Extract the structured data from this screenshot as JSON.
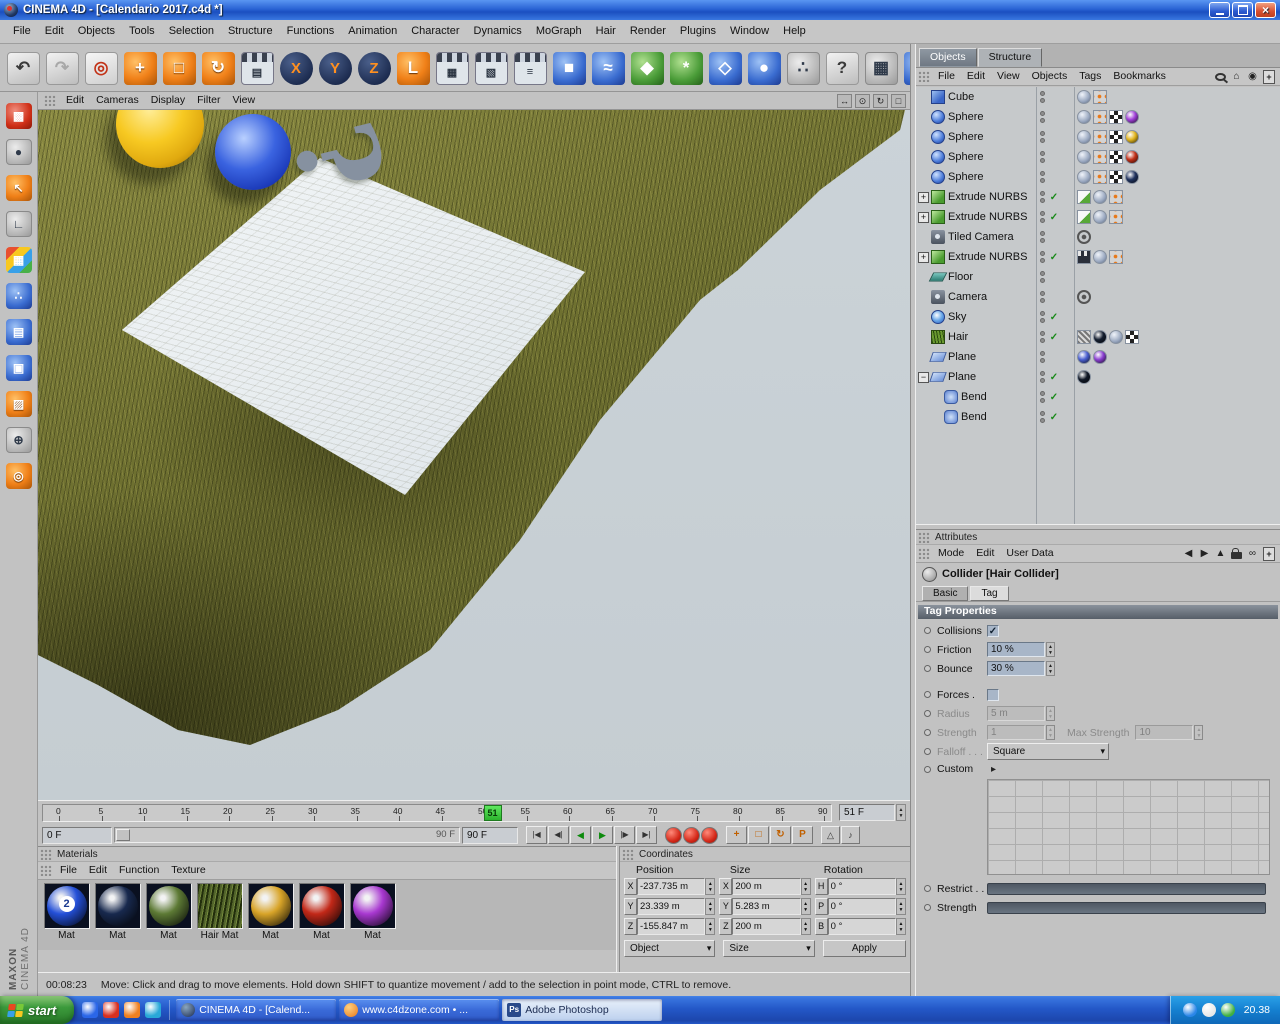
{
  "scene_colors": {
    "background": "#cbd3d8",
    "grass_light": "#8a8a42",
    "grass_dark": "#4f5222",
    "card": "#e2e8ec",
    "sphere_yellow": "#f7c922",
    "sphere_blue": "#3a63e0",
    "question_mark": "#8691a0"
  },
  "scene": {
    "question_mark": "?"
  },
  "titlebar": {
    "title": "CINEMA 4D - [Calendario 2017.c4d *]"
  },
  "menubar": {
    "items": [
      "File",
      "Edit",
      "Objects",
      "Tools",
      "Selection",
      "Structure",
      "Functions",
      "Animation",
      "Character",
      "Dynamics",
      "MoGraph",
      "Hair",
      "Render",
      "Plugins",
      "Window",
      "Help"
    ]
  },
  "toolbar": {
    "items": [
      {
        "name": "undo",
        "glyph": "↶",
        "bg": "plain"
      },
      {
        "name": "redo",
        "glyph": "↷",
        "bg": "plain dim"
      },
      {
        "name": "live-selection",
        "glyph": "◎",
        "bg": "sel"
      },
      {
        "name": "move",
        "glyph": "+",
        "bg": "orange"
      },
      {
        "name": "scale",
        "glyph": "□",
        "bg": "orange"
      },
      {
        "name": "rotate",
        "glyph": "↻",
        "bg": "orange"
      },
      {
        "name": "active-tool",
        "glyph": "▤",
        "bg": "film"
      },
      {
        "name": "lock-x-axis",
        "glyph": "X",
        "bg": "axis"
      },
      {
        "name": "lock-y-axis",
        "glyph": "Y",
        "bg": "axis"
      },
      {
        "name": "lock-z-axis",
        "glyph": "Z",
        "bg": "axis"
      },
      {
        "name": "coordinate-system",
        "glyph": "L",
        "bg": "orange"
      },
      {
        "name": "render-view",
        "glyph": "▦",
        "bg": "film"
      },
      {
        "name": "render-active-view",
        "glyph": "▧",
        "bg": "film"
      },
      {
        "name": "render-settings",
        "glyph": "≡",
        "bg": "film"
      },
      {
        "name": "add-primitive",
        "glyph": "■",
        "bg": "blue"
      },
      {
        "name": "add-spline",
        "glyph": "≈",
        "bg": "blue"
      },
      {
        "name": "add-nurbs",
        "glyph": "◆",
        "bg": "green"
      },
      {
        "name": "add-modeling-object",
        "glyph": "*",
        "bg": "green"
      },
      {
        "name": "add-deformer",
        "glyph": "◇",
        "bg": "blue"
      },
      {
        "name": "add-scene-object",
        "glyph": "●",
        "bg": "blue"
      },
      {
        "name": "add-particles",
        "glyph": "∴",
        "bg": "gray"
      },
      {
        "name": "help",
        "glyph": "?",
        "bg": "plain"
      },
      {
        "name": "structure-manager",
        "glyph": "▦",
        "bg": "gray"
      },
      {
        "name": "content-browser",
        "glyph": "⊕",
        "bg": "blue"
      }
    ]
  },
  "left_toolbar": {
    "items": [
      {
        "name": "make-editable",
        "glyph": "▩",
        "bg": "red"
      },
      {
        "name": "model-mode",
        "glyph": "●",
        "bg": "gray"
      },
      {
        "name": "object-axis-mode",
        "glyph": "↖",
        "bg": "orange"
      },
      {
        "name": "workplane-mode",
        "glyph": "∟",
        "bg": "gray"
      },
      {
        "name": "texture-mode",
        "glyph": "▦",
        "bg": "multi"
      },
      {
        "name": "points-mode",
        "glyph": "∴",
        "bg": "blue"
      },
      {
        "name": "edges-mode",
        "glyph": "▤",
        "bg": "blue"
      },
      {
        "name": "polygons-mode",
        "glyph": "▣",
        "bg": "blue"
      },
      {
        "name": "texture-axis-mode",
        "glyph": "▨",
        "bg": "orange"
      },
      {
        "name": "snap-mode",
        "glyph": "⊕",
        "bg": "gray"
      },
      {
        "name": "selection-filter",
        "glyph": "◎",
        "bg": "orange"
      }
    ]
  },
  "viewport": {
    "menus": [
      "Edit",
      "Cameras",
      "Display",
      "Filter",
      "View"
    ],
    "corner_icons": [
      {
        "name": "pan-view-icon",
        "glyph": "↔"
      },
      {
        "name": "zoom-view-icon",
        "glyph": "⊙"
      },
      {
        "name": "rotate-view-icon",
        "glyph": "↻"
      },
      {
        "name": "maximize-view-icon",
        "glyph": "□"
      }
    ]
  },
  "object_manager": {
    "tabs": [
      {
        "label": "Objects",
        "active": true
      },
      {
        "label": "Structure",
        "active": false
      }
    ],
    "menus": [
      "File",
      "Edit",
      "View",
      "Objects",
      "Tags",
      "Bookmarks"
    ],
    "corner_icons": [
      {
        "name": "search-icon",
        "cls": "icon-search"
      },
      {
        "name": "home-icon",
        "glyph": "⌂"
      },
      {
        "name": "focus-icon",
        "glyph": "◉"
      },
      {
        "name": "add-layer-icon",
        "glyph": "+",
        "cls": "boxed"
      }
    ],
    "objects": [
      {
        "name": "Cube",
        "icon": "cube",
        "depth": 0,
        "tags": [
          {
            "t": "phong"
          },
          {
            "t": "display"
          }
        ]
      },
      {
        "name": "Sphere",
        "icon": "sphere",
        "depth": 0,
        "tags": [
          {
            "t": "phong"
          },
          {
            "t": "display"
          },
          {
            "t": "checker"
          },
          {
            "t": "mat",
            "c": "#a03fd8"
          }
        ]
      },
      {
        "name": "Sphere",
        "icon": "sphere",
        "depth": 0,
        "tags": [
          {
            "t": "phong"
          },
          {
            "t": "display"
          },
          {
            "t": "checker"
          },
          {
            "t": "mat",
            "c": "#e2b51e"
          }
        ]
      },
      {
        "name": "Sphere",
        "icon": "sphere",
        "depth": 0,
        "tags": [
          {
            "t": "phong"
          },
          {
            "t": "display"
          },
          {
            "t": "checker"
          },
          {
            "t": "mat",
            "c": "#c23018"
          }
        ]
      },
      {
        "name": "Sphere",
        "icon": "sphere",
        "depth": 0,
        "tags": [
          {
            "t": "phong"
          },
          {
            "t": "display"
          },
          {
            "t": "checker"
          },
          {
            "t": "mat",
            "c": "#20335f"
          }
        ]
      },
      {
        "name": "Extrude NURBS",
        "icon": "extrude",
        "depth": 0,
        "expand": "+",
        "check": true,
        "tags": [
          {
            "t": "film"
          },
          {
            "t": "phong"
          },
          {
            "t": "display"
          }
        ]
      },
      {
        "name": "Extrude NURBS",
        "icon": "extrude",
        "depth": 0,
        "expand": "+",
        "check": true,
        "tags": [
          {
            "t": "film"
          },
          {
            "t": "phong"
          },
          {
            "t": "display"
          }
        ]
      },
      {
        "name": "Tiled Camera",
        "icon": "camera",
        "depth": 0,
        "tags": [
          {
            "t": "target"
          }
        ]
      },
      {
        "name": "Extrude NURBS",
        "icon": "extrude",
        "depth": 0,
        "expand": "+",
        "check": true,
        "tags": [
          {
            "t": "clapper"
          },
          {
            "t": "phong"
          },
          {
            "t": "display"
          }
        ]
      },
      {
        "name": "Floor",
        "icon": "floor",
        "depth": 0,
        "tags": []
      },
      {
        "name": "Camera",
        "icon": "camera",
        "depth": 0,
        "tags": [
          {
            "t": "target"
          }
        ]
      },
      {
        "name": "Sky",
        "icon": "sky",
        "depth": 0,
        "check": true,
        "tags": []
      },
      {
        "name": "Hair",
        "icon": "hair",
        "depth": 0,
        "check": true,
        "tags": [
          {
            "t": "hatch"
          },
          {
            "t": "mat",
            "c": "#141e30"
          },
          {
            "t": "phong"
          },
          {
            "t": "checker"
          }
        ]
      },
      {
        "name": "Plane",
        "icon": "plane",
        "depth": 0,
        "tags": [
          {
            "t": "mat",
            "c": "#4a5fd0"
          },
          {
            "t": "mat",
            "c": "#8a3fd0"
          }
        ]
      },
      {
        "name": "Plane",
        "icon": "plane",
        "depth": 0,
        "expand": "-",
        "check": true,
        "tags": [
          {
            "t": "mat",
            "c": "#101826"
          }
        ]
      },
      {
        "name": "Bend",
        "icon": "bend",
        "depth": 1,
        "check": true,
        "tags": []
      },
      {
        "name": "Bend",
        "icon": "bend",
        "depth": 1,
        "check": true,
        "tags": []
      }
    ]
  },
  "attributes": {
    "panel_title": "Attributes",
    "menus": [
      "Mode",
      "Edit",
      "User Data"
    ],
    "corner_icons": [
      {
        "name": "nav-back-icon",
        "glyph": "◀"
      },
      {
        "name": "nav-forward-icon",
        "glyph": "▶"
      },
      {
        "name": "arrow-up-icon",
        "glyph": "▲"
      },
      {
        "name": "lock-icon",
        "cls": "icon-lock"
      },
      {
        "name": "link-icon",
        "glyph": "∞"
      },
      {
        "name": "new-panel-icon",
        "glyph": "+",
        "cls": "boxed"
      }
    ],
    "object_title": "Collider [Hair Collider]",
    "tabs": [
      {
        "label": "Basic",
        "active": false
      },
      {
        "label": "Tag",
        "active": true
      }
    ],
    "section": "Tag Properties",
    "rows": {
      "collisions": {
        "label": "Collisions",
        "checked": true
      },
      "friction": {
        "label": "Friction",
        "value": "10 %"
      },
      "bounce": {
        "label": "Bounce",
        "value": "30 %"
      },
      "forces": {
        "label": "Forces .",
        "checked": false
      },
      "radius": {
        "label": "Radius",
        "value": "5 m"
      },
      "strength": {
        "label": "Strength",
        "value": "1"
      },
      "max_strength": {
        "label": "Max Strength",
        "value": "10"
      },
      "falloff": {
        "label": "Falloff . . .",
        "value": "Square"
      },
      "custom": {
        "label": "Custom"
      },
      "restrict": {
        "label": "Restrict . ."
      },
      "strength2": {
        "label": "Strength"
      }
    }
  },
  "timeline": {
    "min": 0,
    "max": 90,
    "step": 5,
    "current": 51,
    "current_field": "51 F",
    "start_field": "0 F",
    "end_field": "90 F",
    "range_end_label": "90 F",
    "transport": [
      {
        "name": "goto-start-button",
        "glyph": "|◀"
      },
      {
        "name": "previous-key-button",
        "glyph": "◀|"
      },
      {
        "name": "play-backward-button",
        "glyph": "◀",
        "green": true
      },
      {
        "name": "play-forward-button",
        "glyph": "▶",
        "green": true
      },
      {
        "name": "next-key-button",
        "glyph": "|▶"
      },
      {
        "name": "goto-end-button",
        "glyph": "▶|"
      }
    ],
    "record_buttons": [
      {
        "name": "record-keyframe-button"
      },
      {
        "name": "autokeying-button"
      },
      {
        "name": "record-selection-button"
      }
    ],
    "key_toggles": [
      {
        "name": "record-position-toggle",
        "glyph": "+"
      },
      {
        "name": "record-scale-toggle",
        "glyph": "□"
      },
      {
        "name": "record-rotation-toggle",
        "glyph": "↻"
      },
      {
        "name": "record-parameter-toggle",
        "glyph": "P"
      }
    ],
    "extra": [
      {
        "name": "record-pla-button",
        "glyph": "△"
      },
      {
        "name": "sound-button",
        "glyph": "♪"
      }
    ]
  },
  "materials": {
    "panel_title": "Materials",
    "menus": [
      "File",
      "Edit",
      "Function",
      "Texture"
    ],
    "items": [
      {
        "label": "Mat",
        "kind": "ball",
        "color": "#2450d8",
        "number": "2"
      },
      {
        "label": "Mat",
        "kind": "ball",
        "color": "#18294e"
      },
      {
        "label": "Mat",
        "kind": "ball",
        "color": "#5d7a35"
      },
      {
        "label": "Hair Mat",
        "kind": "hair"
      },
      {
        "label": "Mat",
        "kind": "ball",
        "color": "#d8a428"
      },
      {
        "label": "Mat",
        "kind": "ball",
        "color": "#c22818"
      },
      {
        "label": "Mat",
        "kind": "ball",
        "color": "#a838d0"
      }
    ]
  },
  "coordinates": {
    "panel_title": "Coordinates",
    "headers": [
      "Position",
      "Size",
      "Rotation"
    ],
    "rows": [
      {
        "cells": [
          {
            "label": "X",
            "value": "-237.735 m"
          },
          {
            "label": "X",
            "value": "200 m"
          },
          {
            "label": "H",
            "value": "0 °"
          }
        ]
      },
      {
        "cells": [
          {
            "label": "Y",
            "value": "23.339 m"
          },
          {
            "label": "Y",
            "value": "5.283 m"
          },
          {
            "label": "P",
            "value": "0 °"
          }
        ]
      },
      {
        "cells": [
          {
            "label": "Z",
            "value": "-155.847 m"
          },
          {
            "label": "Z",
            "value": "200 m"
          },
          {
            "label": "B",
            "value": "0 °"
          }
        ]
      }
    ],
    "footer": {
      "left_dropdown": "Object",
      "right_dropdown": "Size",
      "apply": "Apply"
    }
  },
  "statusbar": {
    "time": "00:08:23",
    "message": "Move: Click and drag to move elements. Hold down SHIFT to quantize movement / add to the selection in point mode, CTRL to remove."
  },
  "taskbar": {
    "start_label": "start",
    "quick_launch": [
      {
        "name": "quick-launch-1",
        "color": "#2a66e8"
      },
      {
        "name": "quick-launch-2",
        "color": "#d83020"
      },
      {
        "name": "quick-launch-3",
        "color": "#f08020"
      },
      {
        "name": "quick-launch-4",
        "color": "#28a8d8"
      }
    ],
    "tasks": [
      {
        "label": "CINEMA 4D - [Calend...",
        "icon": "c4d",
        "active": false
      },
      {
        "label": "www.c4dzone.com • ...",
        "icon": "globe",
        "active": false
      },
      {
        "label": "Adobe Photoshop",
        "icon": "ps",
        "active": true
      }
    ],
    "tray_icons": [
      {
        "name": "tray-icon-1",
        "color": "#2a86e8"
      },
      {
        "name": "tray-icon-2",
        "color": "#e8e8e8"
      },
      {
        "name": "tray-icon-3",
        "color": "#40b040"
      }
    ],
    "clock": "20.38"
  },
  "branding": {
    "maxon": "MAXON",
    "app": "CINEMA 4D"
  }
}
